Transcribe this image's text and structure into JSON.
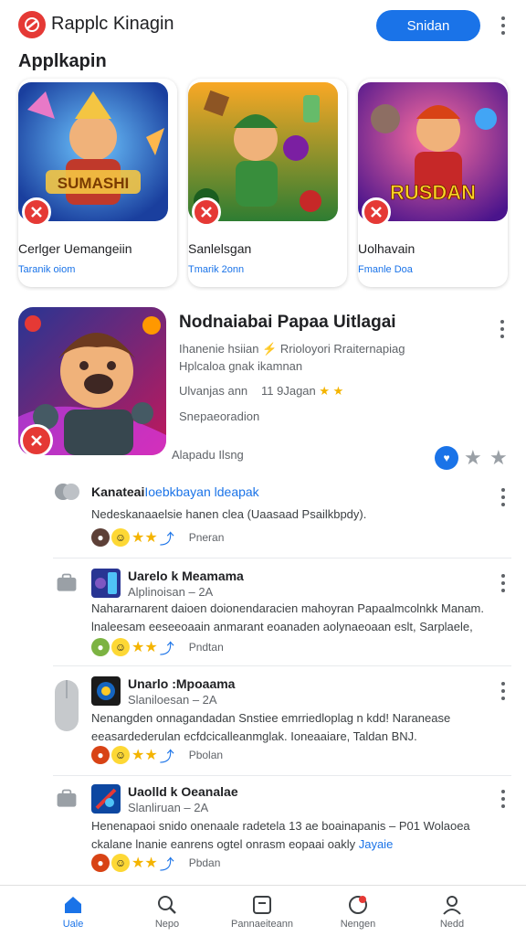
{
  "header": {
    "title": "Rapplc Kinagin",
    "primary_button": "Snidan"
  },
  "section": {
    "title": "Applkapin"
  },
  "cards": [
    {
      "art_text": "SUMASHI",
      "title": "Cerlger Uemangeiin",
      "link": "Taranik oiom"
    },
    {
      "art_text": "",
      "title": "Sanlelsgan",
      "link": "Tmarik 2onn"
    },
    {
      "art_text": "RUSDAN",
      "title": "Uolhavain",
      "link": "Fmanle Doa"
    }
  ],
  "feature": {
    "title": "Nodnaiabai Papaa Uitlagai",
    "description": "Ihanenie hsiian ⚡ Rrioloyori Rraiternapiag Hplcaloa gnak ikamnan",
    "meta_left": "Ulvanjas ann",
    "meta_rating": "11 9Jagan",
    "meta_status": "Snepaeoradion",
    "footer": "Alapadu Ilsng"
  },
  "posts": [
    {
      "title": "Kanateai",
      "title_link": "Ioebkbayan ldeapak",
      "subtitle": "",
      "body": "Nedeskanaaelsie hanen clea (Uaasaad Psailkbpdy).",
      "reaction_label": "Pneran"
    },
    {
      "title": "Uarelo k Meamama",
      "title_link": "",
      "subtitle": "Alplinoisan – 2A",
      "body": "Nahararnarent daioen doionendaracien mahoyran Papaalmcolnkk Manam. lnaleesam eeseeoaain anmarant eoanaden aolynaeoaan eslt, Sarplaele,",
      "body_link": "",
      "reaction_label": "Pndtan"
    },
    {
      "title": "Unarlo :Mpoaama",
      "title_link": "",
      "subtitle": "Slaniloesan – 2A",
      "body": "Nenangden onnagandadan Snstiee emrriedloplag n kdd! Naranease eeasardederulan ecfdcicalleanmglak. Ioneaaiare, Taldan BNJ.",
      "body_link": "",
      "reaction_label": "Pbolan"
    },
    {
      "title": "Uaolld k Oeanalae",
      "title_link": "",
      "subtitle": "Slanliruan – 2A",
      "body": "Henenapaoi snido onenaale radetela 13 ae boainapanis – P01 Wolaoea ckalane lnanie eanrens ogtel onrasm eopaai oakly",
      "body_link": "Jayaie",
      "reaction_label": "Pbdan"
    }
  ],
  "nav": [
    {
      "label": "Uale",
      "icon": "home-icon"
    },
    {
      "label": "Nepo",
      "icon": "search-icon"
    },
    {
      "label": "Pannaeiteann",
      "icon": "inbox-icon"
    },
    {
      "label": "Nengen",
      "icon": "bell-icon"
    },
    {
      "label": "Nedd",
      "icon": "profile-icon"
    }
  ],
  "colors": {
    "accent": "#1a73e8",
    "brand": "#e53935",
    "star": "#f4b400"
  }
}
